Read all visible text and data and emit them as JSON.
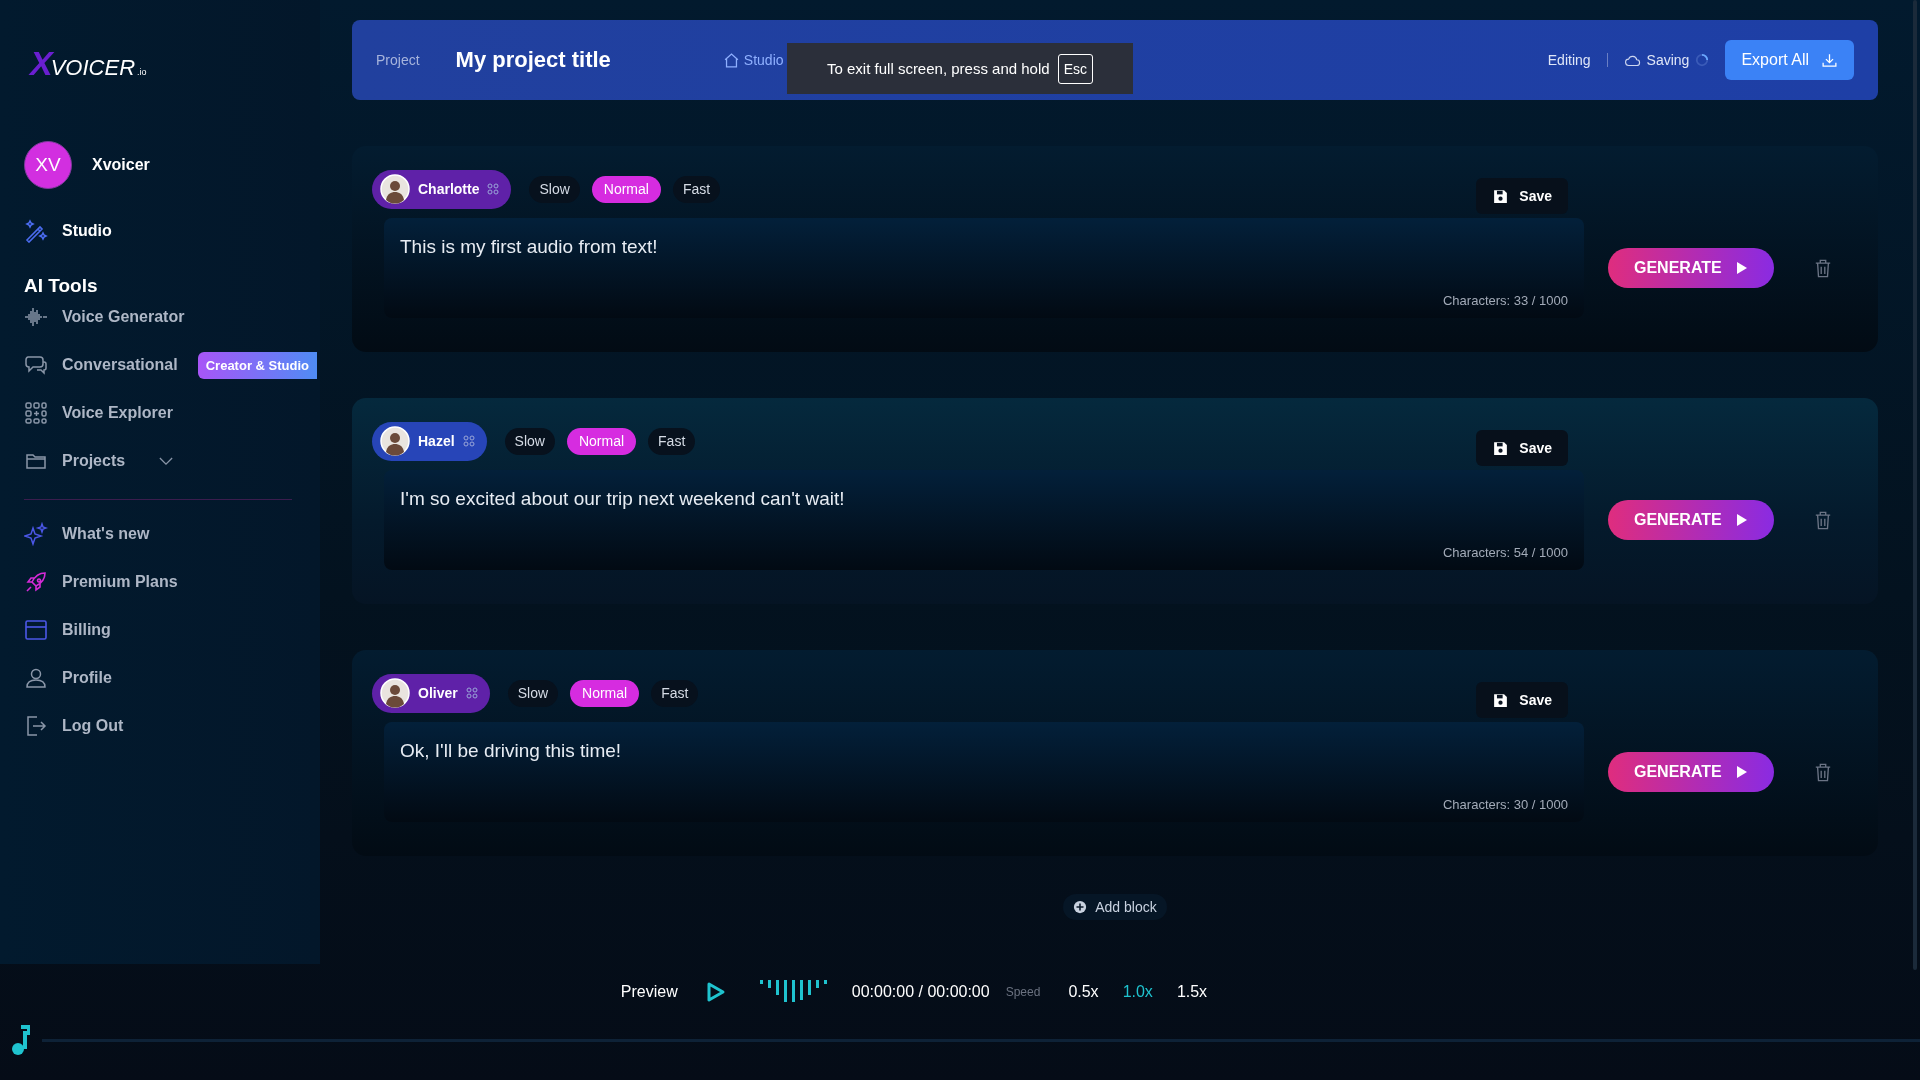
{
  "logo": {
    "text": "VOICER",
    "mark": "X",
    "suffix": ".io"
  },
  "user": {
    "initials": "XV",
    "name": "Xvoicer"
  },
  "studio_link": "Studio",
  "section_title": "AI Tools",
  "tools": [
    {
      "label": "Voice Generator"
    },
    {
      "label": "Conversational",
      "badge": "Creator & Studio"
    },
    {
      "label": "Voice Explorer"
    },
    {
      "label": "Projects",
      "expanded": false
    }
  ],
  "links": [
    {
      "label": "What's new"
    },
    {
      "label": "Premium Plans"
    },
    {
      "label": "Billing"
    },
    {
      "label": "Profile"
    },
    {
      "label": "Log Out"
    }
  ],
  "header": {
    "project_label": "Project",
    "title": "My project title",
    "breadcrumb": "Studio",
    "status": "Editing",
    "saving": "Saving",
    "export": "Export All"
  },
  "fullscreen_notice": {
    "text": "To exit full screen, press and hold",
    "key": "Esc"
  },
  "blocks": [
    {
      "voice": "Charlotte",
      "selected": false,
      "speeds": [
        {
          "label": "Slow",
          "selected": false
        },
        {
          "label": "Normal",
          "selected": true
        },
        {
          "label": "Fast",
          "selected": false
        }
      ],
      "save": "Save",
      "text": "This is my first audio from text!",
      "characters": "Characters: 33 / 1000",
      "generate": "GENERATE"
    },
    {
      "voice": "Hazel",
      "selected": true,
      "speeds": [
        {
          "label": "Slow",
          "selected": false
        },
        {
          "label": "Normal",
          "selected": true
        },
        {
          "label": "Fast",
          "selected": false
        }
      ],
      "save": "Save",
      "text": "I'm so excited about our trip next weekend can't wait!",
      "characters": "Characters: 54 / 1000",
      "generate": "GENERATE"
    },
    {
      "voice": "Oliver",
      "selected": false,
      "speeds": [
        {
          "label": "Slow",
          "selected": false
        },
        {
          "label": "Normal",
          "selected": true
        },
        {
          "label": "Fast",
          "selected": false
        }
      ],
      "save": "Save",
      "text": "Ok, I'll be driving this time!",
      "characters": "Characters: 30 / 1000",
      "generate": "GENERATE"
    }
  ],
  "add_block": "Add block",
  "player": {
    "label": "Preview",
    "time": "00:00:00 / 00:00:00",
    "speed_label": "Speed",
    "speeds": [
      {
        "label": "0.5x",
        "selected": false
      },
      {
        "label": "1.0x",
        "selected": true
      },
      {
        "label": "1.5x",
        "selected": false
      }
    ]
  }
}
